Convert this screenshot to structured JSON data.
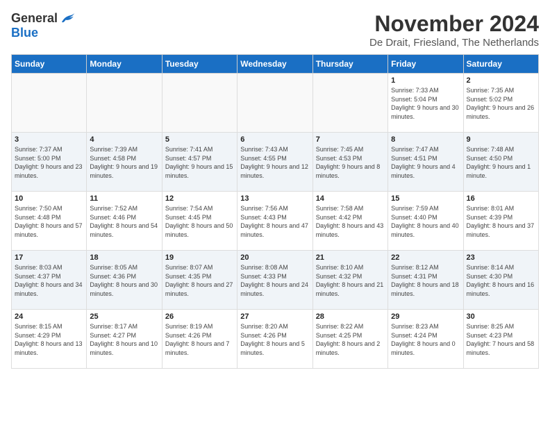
{
  "header": {
    "logo_general": "General",
    "logo_blue": "Blue",
    "month_title": "November 2024",
    "location": "De Drait, Friesland, The Netherlands"
  },
  "weekdays": [
    "Sunday",
    "Monday",
    "Tuesday",
    "Wednesday",
    "Thursday",
    "Friday",
    "Saturday"
  ],
  "weeks": [
    [
      {
        "day": "",
        "info": ""
      },
      {
        "day": "",
        "info": ""
      },
      {
        "day": "",
        "info": ""
      },
      {
        "day": "",
        "info": ""
      },
      {
        "day": "",
        "info": ""
      },
      {
        "day": "1",
        "info": "Sunrise: 7:33 AM\nSunset: 5:04 PM\nDaylight: 9 hours and 30 minutes."
      },
      {
        "day": "2",
        "info": "Sunrise: 7:35 AM\nSunset: 5:02 PM\nDaylight: 9 hours and 26 minutes."
      }
    ],
    [
      {
        "day": "3",
        "info": "Sunrise: 7:37 AM\nSunset: 5:00 PM\nDaylight: 9 hours and 23 minutes."
      },
      {
        "day": "4",
        "info": "Sunrise: 7:39 AM\nSunset: 4:58 PM\nDaylight: 9 hours and 19 minutes."
      },
      {
        "day": "5",
        "info": "Sunrise: 7:41 AM\nSunset: 4:57 PM\nDaylight: 9 hours and 15 minutes."
      },
      {
        "day": "6",
        "info": "Sunrise: 7:43 AM\nSunset: 4:55 PM\nDaylight: 9 hours and 12 minutes."
      },
      {
        "day": "7",
        "info": "Sunrise: 7:45 AM\nSunset: 4:53 PM\nDaylight: 9 hours and 8 minutes."
      },
      {
        "day": "8",
        "info": "Sunrise: 7:47 AM\nSunset: 4:51 PM\nDaylight: 9 hours and 4 minutes."
      },
      {
        "day": "9",
        "info": "Sunrise: 7:48 AM\nSunset: 4:50 PM\nDaylight: 9 hours and 1 minute."
      }
    ],
    [
      {
        "day": "10",
        "info": "Sunrise: 7:50 AM\nSunset: 4:48 PM\nDaylight: 8 hours and 57 minutes."
      },
      {
        "day": "11",
        "info": "Sunrise: 7:52 AM\nSunset: 4:46 PM\nDaylight: 8 hours and 54 minutes."
      },
      {
        "day": "12",
        "info": "Sunrise: 7:54 AM\nSunset: 4:45 PM\nDaylight: 8 hours and 50 minutes."
      },
      {
        "day": "13",
        "info": "Sunrise: 7:56 AM\nSunset: 4:43 PM\nDaylight: 8 hours and 47 minutes."
      },
      {
        "day": "14",
        "info": "Sunrise: 7:58 AM\nSunset: 4:42 PM\nDaylight: 8 hours and 43 minutes."
      },
      {
        "day": "15",
        "info": "Sunrise: 7:59 AM\nSunset: 4:40 PM\nDaylight: 8 hours and 40 minutes."
      },
      {
        "day": "16",
        "info": "Sunrise: 8:01 AM\nSunset: 4:39 PM\nDaylight: 8 hours and 37 minutes."
      }
    ],
    [
      {
        "day": "17",
        "info": "Sunrise: 8:03 AM\nSunset: 4:37 PM\nDaylight: 8 hours and 34 minutes."
      },
      {
        "day": "18",
        "info": "Sunrise: 8:05 AM\nSunset: 4:36 PM\nDaylight: 8 hours and 30 minutes."
      },
      {
        "day": "19",
        "info": "Sunrise: 8:07 AM\nSunset: 4:35 PM\nDaylight: 8 hours and 27 minutes."
      },
      {
        "day": "20",
        "info": "Sunrise: 8:08 AM\nSunset: 4:33 PM\nDaylight: 8 hours and 24 minutes."
      },
      {
        "day": "21",
        "info": "Sunrise: 8:10 AM\nSunset: 4:32 PM\nDaylight: 8 hours and 21 minutes."
      },
      {
        "day": "22",
        "info": "Sunrise: 8:12 AM\nSunset: 4:31 PM\nDaylight: 8 hours and 18 minutes."
      },
      {
        "day": "23",
        "info": "Sunrise: 8:14 AM\nSunset: 4:30 PM\nDaylight: 8 hours and 16 minutes."
      }
    ],
    [
      {
        "day": "24",
        "info": "Sunrise: 8:15 AM\nSunset: 4:29 PM\nDaylight: 8 hours and 13 minutes."
      },
      {
        "day": "25",
        "info": "Sunrise: 8:17 AM\nSunset: 4:27 PM\nDaylight: 8 hours and 10 minutes."
      },
      {
        "day": "26",
        "info": "Sunrise: 8:19 AM\nSunset: 4:26 PM\nDaylight: 8 hours and 7 minutes."
      },
      {
        "day": "27",
        "info": "Sunrise: 8:20 AM\nSunset: 4:26 PM\nDaylight: 8 hours and 5 minutes."
      },
      {
        "day": "28",
        "info": "Sunrise: 8:22 AM\nSunset: 4:25 PM\nDaylight: 8 hours and 2 minutes."
      },
      {
        "day": "29",
        "info": "Sunrise: 8:23 AM\nSunset: 4:24 PM\nDaylight: 8 hours and 0 minutes."
      },
      {
        "day": "30",
        "info": "Sunrise: 8:25 AM\nSunset: 4:23 PM\nDaylight: 7 hours and 58 minutes."
      }
    ]
  ]
}
